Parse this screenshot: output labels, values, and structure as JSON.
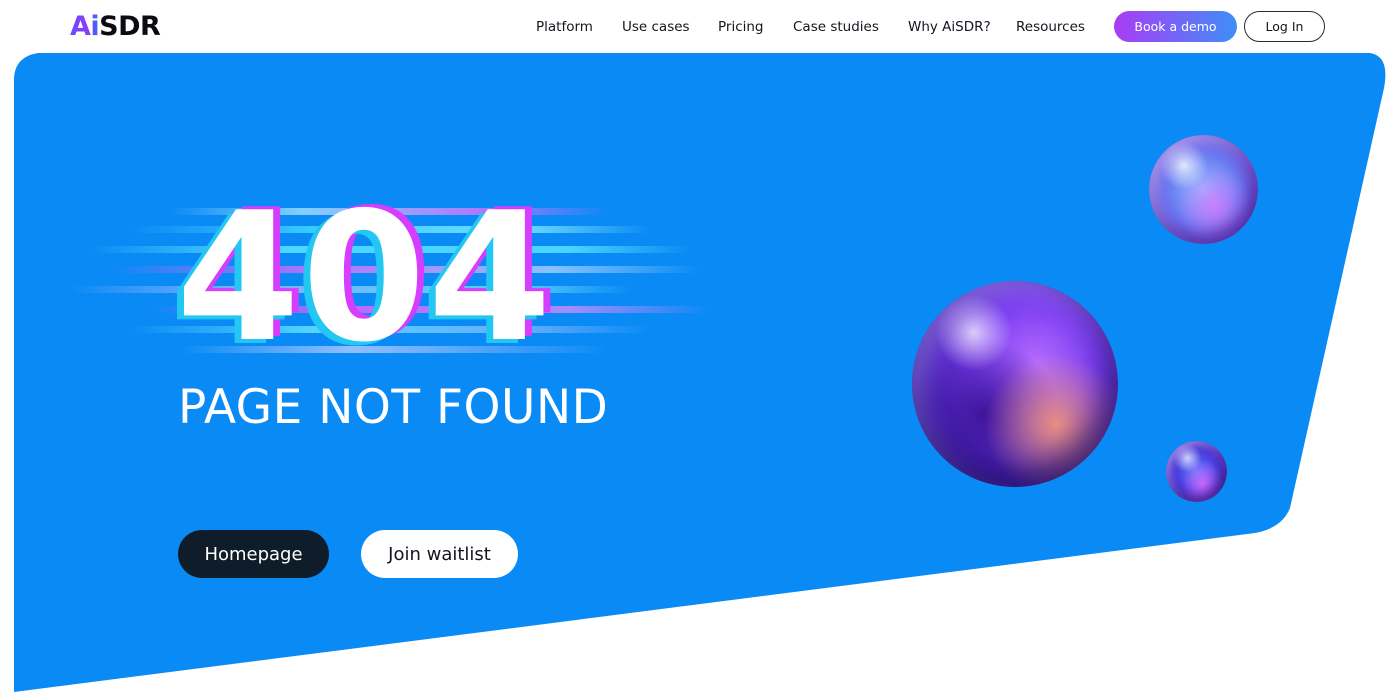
{
  "brand": {
    "logo_prefix": "Ai",
    "logo_suffix": "SDR"
  },
  "nav": {
    "items": [
      {
        "label": "Platform"
      },
      {
        "label": "Use cases"
      },
      {
        "label": "Pricing"
      },
      {
        "label": "Case studies"
      },
      {
        "label": "Why AiSDR?"
      },
      {
        "label": "Resources"
      }
    ],
    "book_demo_label": "Book a demo",
    "login_label": "Log In"
  },
  "hero": {
    "error_code": "404",
    "message": "PAGE NOT FOUND",
    "homepage_label": "Homepage",
    "waitlist_label": "Join waitlist"
  },
  "colors": {
    "hero_blue": "#0a8af5",
    "dark_button": "#0f1d2b",
    "demo_gradient_start": "#a93cf5",
    "demo_gradient_end": "#3f8ef7",
    "cyan_accent": "#23c7f2",
    "magenta_accent": "#d63dff"
  },
  "icons": {
    "logo": "aisdr-logo",
    "decorations": [
      "glass-sphere-large",
      "glass-sphere-top",
      "glass-sphere-small"
    ]
  }
}
